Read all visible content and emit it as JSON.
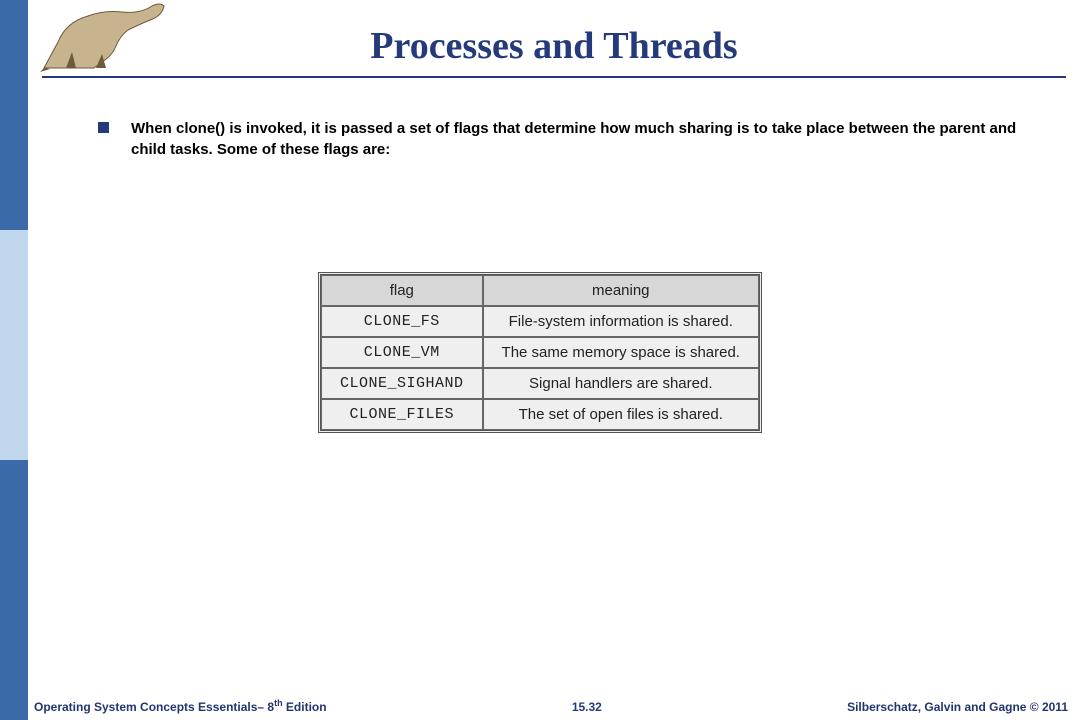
{
  "title": "Processes and Threads",
  "bullet": "When clone() is invoked, it is passed a set of flags that determine how much sharing is to take place between the parent and child tasks. Some of these flags are:",
  "table": {
    "headers": {
      "col1": "flag",
      "col2": "meaning"
    },
    "rows": [
      {
        "flag": "CLONE_FS",
        "meaning": "File-system information is shared."
      },
      {
        "flag": "CLONE_VM",
        "meaning": "The same memory space is shared."
      },
      {
        "flag": "CLONE_SIGHAND",
        "meaning": "Signal handlers are shared."
      },
      {
        "flag": "CLONE_FILES",
        "meaning": "The set of open files is shared."
      }
    ]
  },
  "footer": {
    "left_pre": "Operating System Concepts Essentials– 8",
    "left_sup": "th",
    "left_post": " Edition",
    "page": "15.32",
    "right": "Silberschatz, Galvin and Gagne © 2011"
  }
}
